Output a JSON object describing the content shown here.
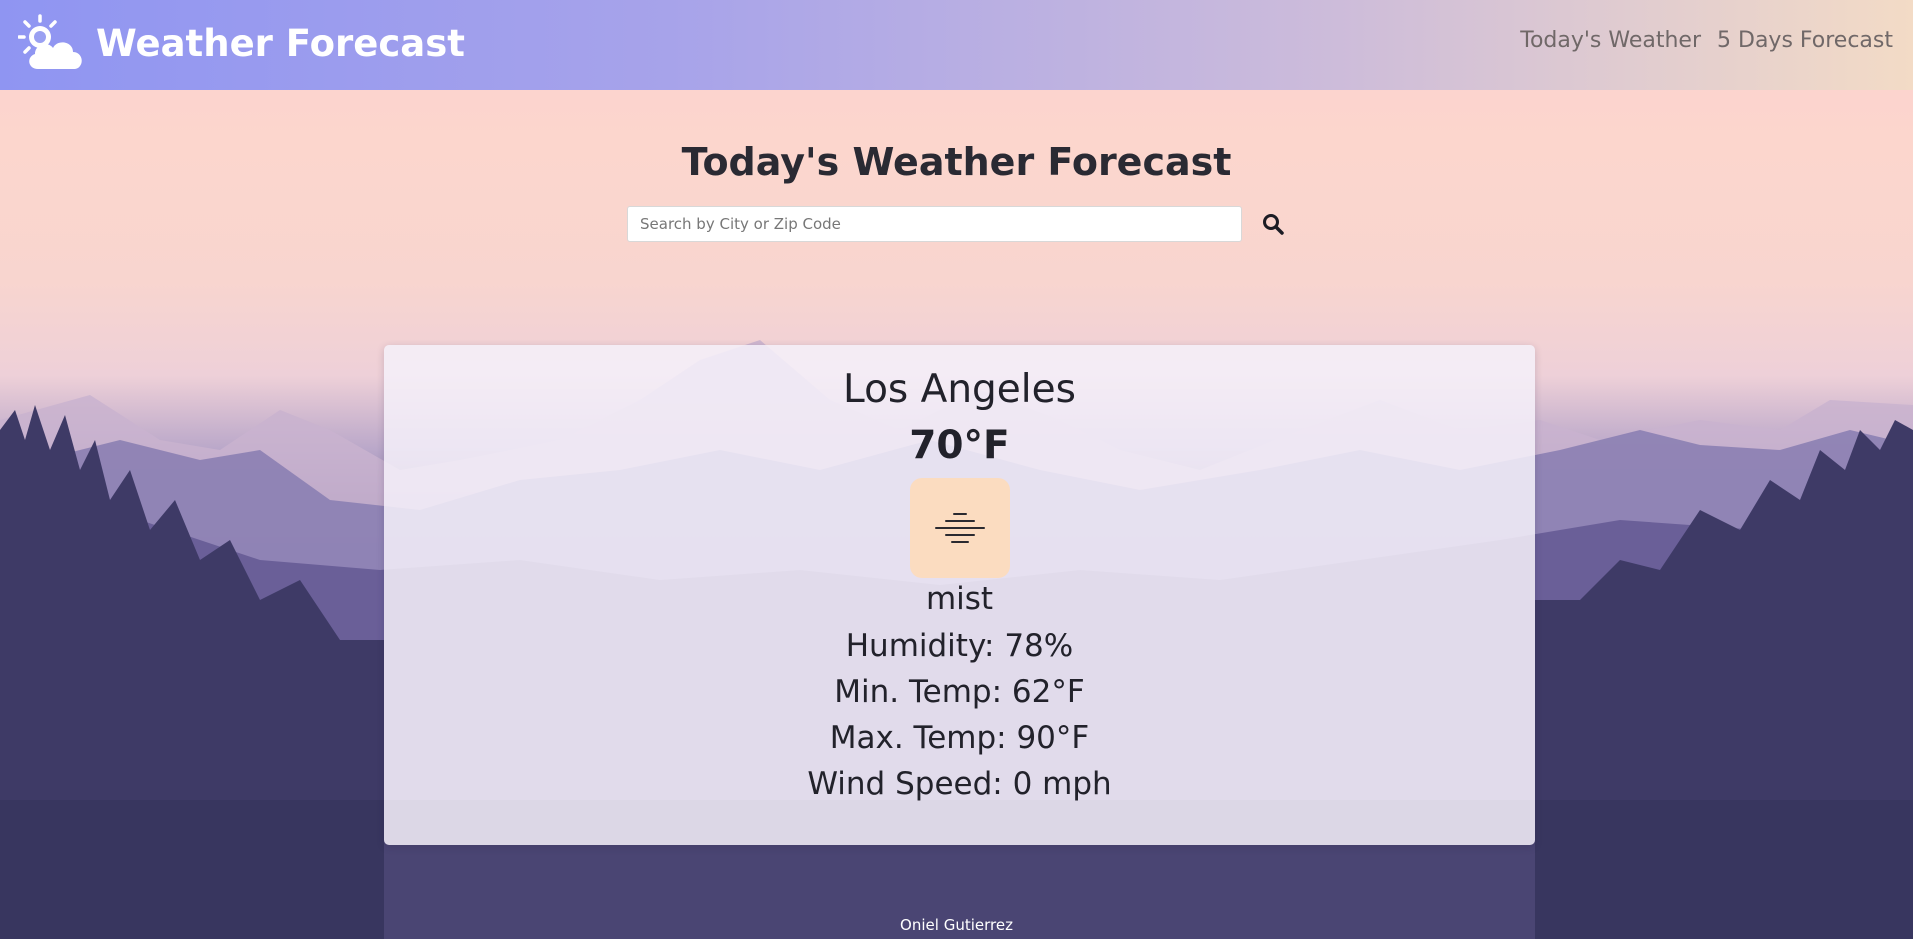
{
  "header": {
    "brand_title": "Weather Forecast",
    "nav": [
      {
        "label": "Today's Weather"
      },
      {
        "label": "5 Days Forecast"
      }
    ]
  },
  "main": {
    "heading": "Today's Weather Forecast",
    "search": {
      "placeholder": "Search by City or Zip Code",
      "value": ""
    }
  },
  "weather": {
    "city": "Los Angeles",
    "temperature": "70°F",
    "icon": "mist-icon",
    "description": "mist",
    "humidity": "Humidity: 78%",
    "min_temp": "Min. Temp: 62°F",
    "max_temp": "Max. Temp: 90°F",
    "wind": "Wind Speed: 0 mph"
  },
  "footer": {
    "author": "Oniel Gutierrez"
  },
  "colors": {
    "navbar_start": "#8f95f2",
    "navbar_end": "#f3dbc6",
    "icon_tile": "#fbdcc0",
    "text_dark": "#22222b"
  }
}
